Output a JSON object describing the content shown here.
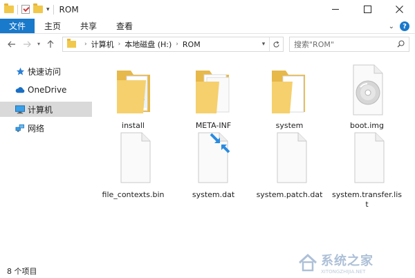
{
  "window": {
    "title": "ROM"
  },
  "ribbon": {
    "tabs": [
      "文件",
      "主页",
      "共享",
      "查看"
    ]
  },
  "address": {
    "crumbs": [
      "计算机",
      "本地磁盘 (H:)",
      "ROM"
    ]
  },
  "search": {
    "placeholder": "搜索\"ROM\""
  },
  "navpane": {
    "items": [
      {
        "label": "快速访问",
        "icon": "star-icon"
      },
      {
        "label": "OneDrive",
        "icon": "cloud-icon"
      },
      {
        "label": "计算机",
        "icon": "computer-icon",
        "selected": true
      },
      {
        "label": "网络",
        "icon": "network-icon"
      }
    ]
  },
  "files": [
    {
      "name": "install",
      "type": "folder-full"
    },
    {
      "name": "META-INF",
      "type": "folder-docs"
    },
    {
      "name": "system",
      "type": "folder-doc"
    },
    {
      "name": "boot.img",
      "type": "disc-image"
    },
    {
      "name": "file_contexts.bin",
      "type": "file"
    },
    {
      "name": "system.dat",
      "type": "file-compressed"
    },
    {
      "name": "system.patch.dat",
      "type": "file"
    },
    {
      "name": "system.transfer.list",
      "type": "file"
    }
  ],
  "status": {
    "count": "8 个项目"
  },
  "watermark": {
    "text": "系统之家",
    "sub": "XITONGZHIJIA.NET"
  },
  "colors": {
    "accent": "#1979ca",
    "folder": "#f1c84b",
    "selected": "#d9d9d9"
  }
}
